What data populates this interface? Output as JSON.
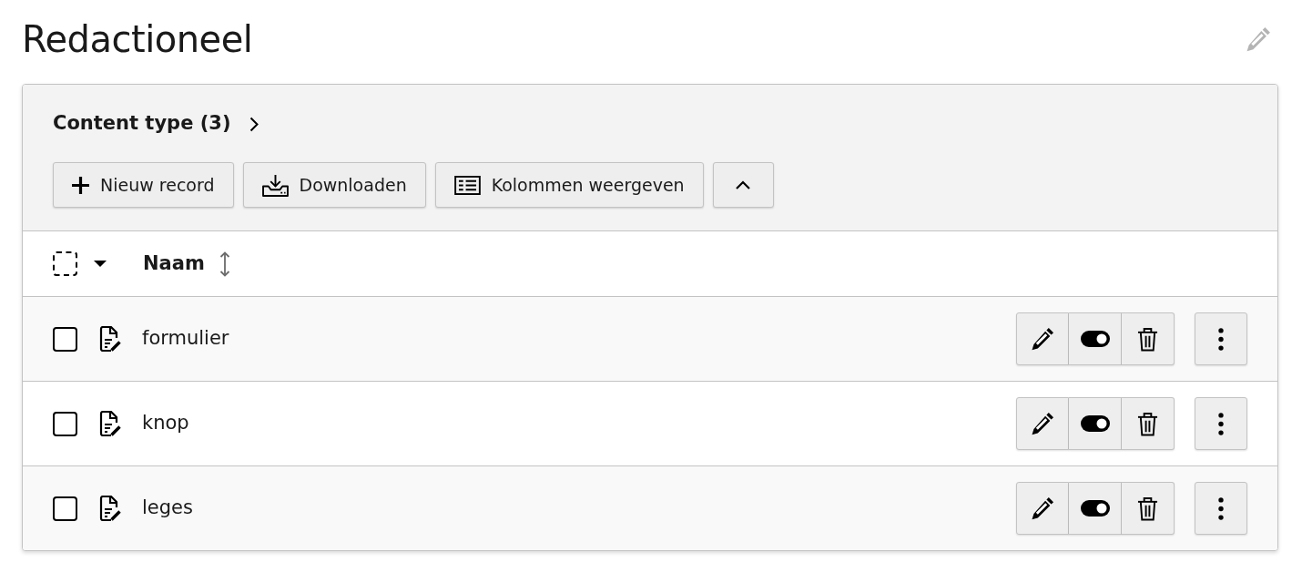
{
  "page": {
    "title": "Redactioneel"
  },
  "panel": {
    "title": "Content type (3)",
    "expanded": true,
    "buttons": [
      {
        "kind": "new",
        "label": "Nieuw record"
      },
      {
        "kind": "download",
        "label": "Downloaden"
      },
      {
        "kind": "columns",
        "label": "Kolommen weergeven"
      }
    ],
    "select_all": {
      "checked": false
    },
    "columns": [
      {
        "label": "Naam"
      }
    ],
    "rows": [
      {
        "name": "formulier",
        "checked": false,
        "enabled": true
      },
      {
        "name": "knop",
        "checked": false,
        "enabled": true
      },
      {
        "name": "leges",
        "checked": false,
        "enabled": true
      }
    ]
  }
}
